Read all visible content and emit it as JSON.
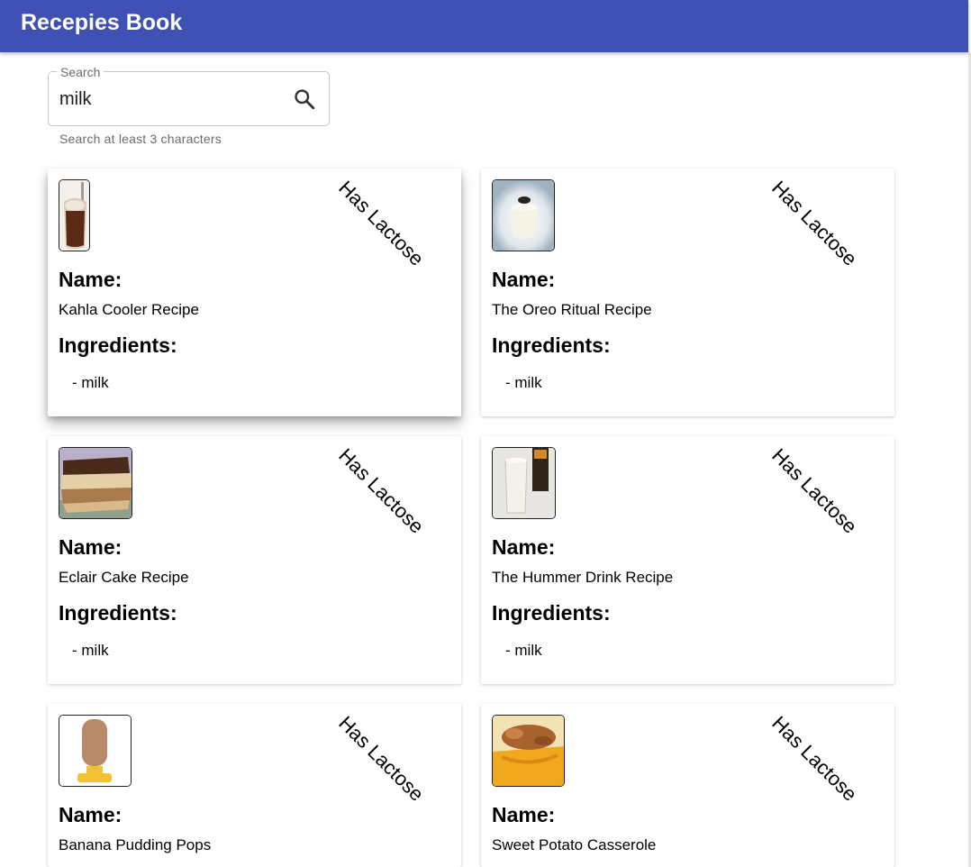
{
  "app": {
    "title": "Recepies Book"
  },
  "search": {
    "label": "Search",
    "value": "milk",
    "hint": "Search at least 3 characters",
    "icon": "search-icon"
  },
  "labels": {
    "name": "Name:",
    "ingredients": "Ingredients:",
    "lactose_badge": "Has Lactose"
  },
  "recipes": [
    {
      "name": "Kahla Cooler Recipe",
      "ingredients": [
        "- milk"
      ],
      "thumbnail": "iced coffee drink in glass"
    },
    {
      "name": "The Oreo Ritual Recipe",
      "ingredients": [
        "- milk"
      ],
      "thumbnail": "glass of milk with oreo"
    },
    {
      "name": "Eclair Cake Recipe",
      "ingredients": [
        "- milk"
      ],
      "thumbnail": "layered eclair cake slice"
    },
    {
      "name": "The Hummer Drink Recipe",
      "ingredients": [
        "- milk"
      ],
      "thumbnail": "milky drink with bottle"
    },
    {
      "name": "Banana Pudding Pops",
      "ingredients": [],
      "thumbnail": "banana pudding popsicle"
    },
    {
      "name": "Sweet Potato Casserole",
      "ingredients": [],
      "thumbnail": "sweet potato casserole in dish"
    }
  ]
}
